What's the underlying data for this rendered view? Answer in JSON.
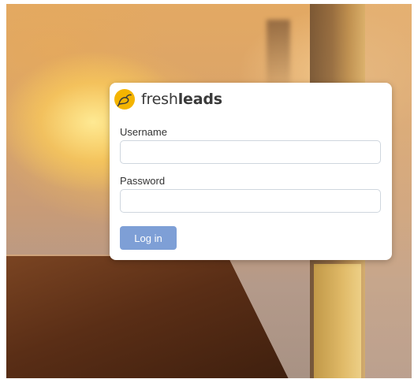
{
  "brand": {
    "name_light": "fresh",
    "name_bold": "leads",
    "logo_icon": "bird-icon",
    "logo_color": "#f4b400"
  },
  "login": {
    "username_label": "Username",
    "username_value": "",
    "username_placeholder": "",
    "password_label": "Password",
    "password_value": "",
    "password_placeholder": "",
    "submit_label": "Log in",
    "submit_color": "#7e9fd6"
  }
}
